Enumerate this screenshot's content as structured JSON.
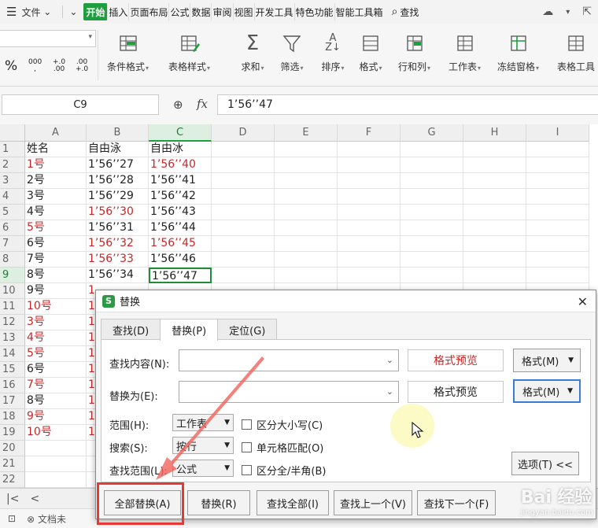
{
  "menubar": {
    "file": "文件",
    "tabs": [
      "开始",
      "插入",
      "页面布局",
      "公式",
      "数据",
      "审阅",
      "视图",
      "开发工具",
      "特色功能",
      "智能工具箱"
    ],
    "search": "查找"
  },
  "ribbon": {
    "numfmt": {
      "percent": "%",
      "thousands": "000",
      "inc_decimal_top": "+.0",
      "inc_decimal_bottom": ".00",
      "dec_decimal_top": ".00",
      "dec_decimal_bottom": "+.0"
    },
    "buttons": [
      {
        "label": "条件格式",
        "icon": "conditional-format-icon"
      },
      {
        "label": "表格样式",
        "icon": "table-style-icon"
      },
      {
        "label": "求和",
        "icon": "sum-icon"
      },
      {
        "label": "筛选",
        "icon": "filter-icon"
      },
      {
        "label": "排序",
        "icon": "sort-icon"
      },
      {
        "label": "格式",
        "icon": "format-icon"
      },
      {
        "label": "行和列",
        "icon": "row-col-icon"
      },
      {
        "label": "工作表",
        "icon": "worksheet-icon"
      },
      {
        "label": "冻结窗格",
        "icon": "freeze-icon"
      },
      {
        "label": "表格工具",
        "icon": "table-tools-icon"
      }
    ]
  },
  "formula_bar": {
    "cell_ref": "C9",
    "fx": "fx",
    "value": "1’56’’47"
  },
  "sheet": {
    "columns": [
      "A",
      "B",
      "C",
      "D",
      "E",
      "F",
      "G",
      "H",
      "I"
    ],
    "rows": [
      {
        "n": "1",
        "a": "姓名",
        "b": "自由泳",
        "c": "自由冰"
      },
      {
        "n": "2",
        "a": "1号",
        "b": "1’56’’27",
        "c": "1’56’’40"
      },
      {
        "n": "3",
        "a": "2号",
        "b": "1’56’’28",
        "c": "1’56’’41"
      },
      {
        "n": "4",
        "a": "3号",
        "b": "1’56’’29",
        "c": "1’56’’42"
      },
      {
        "n": "5",
        "a": "4号",
        "b": "1’56’’30",
        "c": "1’56’’43"
      },
      {
        "n": "6",
        "a": "5号",
        "b": "1’56’’31",
        "c": "1’56’’44"
      },
      {
        "n": "7",
        "a": "6号",
        "b": "1’56’’32",
        "c": "1’56’’45"
      },
      {
        "n": "8",
        "a": "7号",
        "b": "1’56’’33",
        "c": "1’56’’46"
      },
      {
        "n": "9",
        "a": "8号",
        "b": "1’56’’34",
        "c": "1’56’’47"
      },
      {
        "n": "10",
        "a": "9号",
        "b": "1",
        "c": ""
      },
      {
        "n": "11",
        "a": "10号",
        "b": "1",
        "c": ""
      },
      {
        "n": "12",
        "a": "3号",
        "b": "1",
        "c": ""
      },
      {
        "n": "13",
        "a": "4号",
        "b": "1",
        "c": ""
      },
      {
        "n": "14",
        "a": "5号",
        "b": "1",
        "c": ""
      },
      {
        "n": "15",
        "a": "6号",
        "b": "1",
        "c": ""
      },
      {
        "n": "16",
        "a": "7号",
        "b": "1",
        "c": ""
      },
      {
        "n": "17",
        "a": "8号",
        "b": "1",
        "c": ""
      },
      {
        "n": "18",
        "a": "9号",
        "b": "1",
        "c": ""
      },
      {
        "n": "19",
        "a": "10号",
        "b": "1",
        "c": ""
      },
      {
        "n": "20",
        "a": "",
        "b": "",
        "c": ""
      },
      {
        "n": "21",
        "a": "",
        "b": "",
        "c": ""
      },
      {
        "n": "22",
        "a": "",
        "b": "",
        "c": ""
      }
    ],
    "red_a_rows": [
      2,
      6,
      11,
      12,
      13,
      14,
      16,
      18,
      19
    ],
    "red_b_rows": [
      5,
      7,
      8
    ],
    "red_c_rows": [
      2,
      7
    ],
    "accent": "#1e9e3e",
    "red": "#c62828"
  },
  "statusbar": {
    "doc_label": "文档未"
  },
  "dialog": {
    "title": "替换",
    "tabs": [
      "查找(D)",
      "替换(P)",
      "定位(G)"
    ],
    "find_label": "查找内容(N):",
    "replace_label": "替换为(E):",
    "format_preview": "格式预览",
    "format_button": "格式(M)",
    "scope_label": "范围(H):",
    "scope_value": "工作表",
    "search_label": "搜索(S):",
    "search_value": "按行",
    "lookin_label": "查找范围(L):",
    "lookin_value": "公式",
    "match_case": "区分大小写(C)",
    "match_cell": "单元格匹配(O)",
    "match_width": "区分全/半角(B)",
    "options_button": "选项(T) <<",
    "replace_all": "全部替换(A)",
    "replace": "替换(R)",
    "find_all": "查找全部(I)",
    "find_prev": "查找上一个(V)",
    "find_next": "查找下一个(F)"
  },
  "watermark": {
    "brand": "Bai 经验",
    "url": "jingyan.baidu.com"
  }
}
